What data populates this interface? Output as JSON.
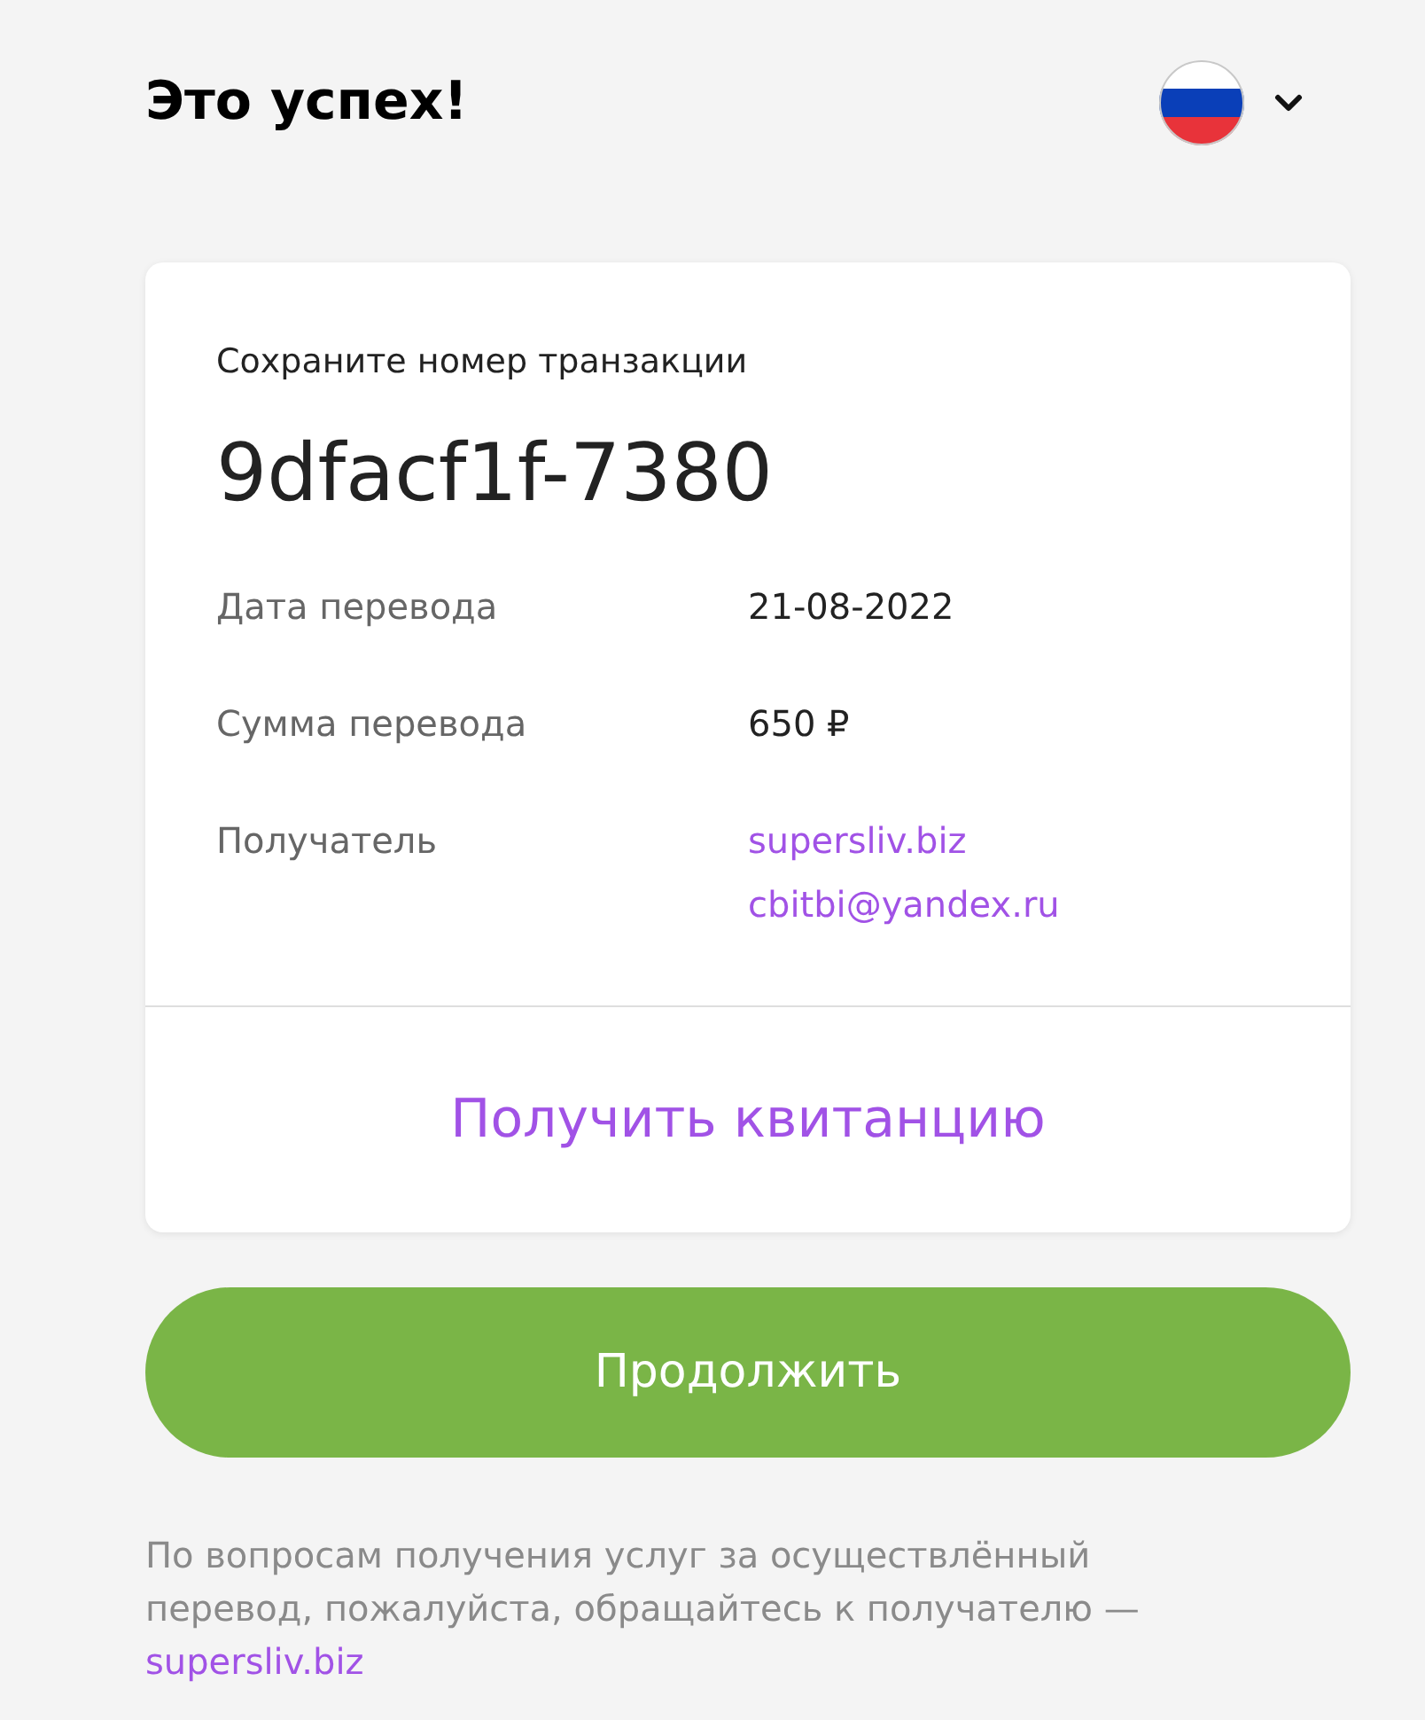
{
  "header": {
    "title": "Это успех!"
  },
  "card": {
    "caption": "Сохраните номер транзакции",
    "transaction_id": "9dfacf1f-7380",
    "details": [
      {
        "label": "Дата перевода",
        "values": [
          {
            "kind": "text",
            "text": "21-08-2022"
          }
        ]
      },
      {
        "label": "Сумма перевода",
        "values": [
          {
            "kind": "text",
            "text": "650 ₽"
          }
        ]
      },
      {
        "label": "Получатель",
        "values": [
          {
            "kind": "link",
            "text": "supersliv.biz"
          },
          {
            "kind": "link",
            "text": "cbitbi@yandex.ru"
          }
        ]
      }
    ],
    "receipt_link": "Получить квитанцию"
  },
  "continue_button": {
    "label": "Продолжить"
  },
  "footer": {
    "text": "По вопросам получения услуг за осуществлённый перевод, пожалуйста, обращайтесь к получателю —",
    "link": "supersliv.biz"
  }
}
